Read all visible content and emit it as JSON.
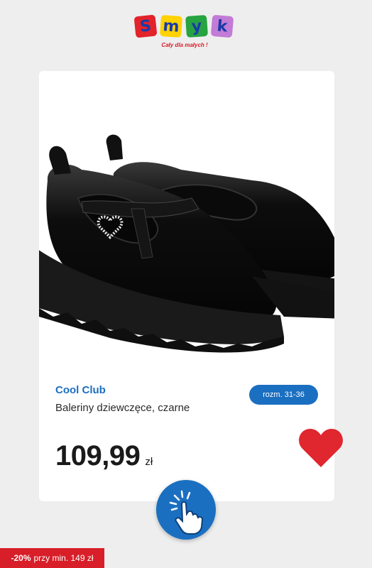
{
  "logo": {
    "letters": [
      "S",
      "m",
      "y",
      "k"
    ],
    "tile_colors": [
      "#e2232a",
      "#ffd200",
      "#27a342",
      "#c27bd6"
    ],
    "tagline": "Cały dla małych !"
  },
  "product": {
    "brand": "Cool Club",
    "name": "Baleriny dziewczęce, czarne",
    "size_label": "rozm. 31-36",
    "price": "109,99",
    "currency": "zł"
  },
  "icons": {
    "favorite": "heart-icon",
    "tap": "tap-hand-icon"
  },
  "promo": {
    "discount": "-20%",
    "condition": "przy min. 149 zł"
  },
  "colors": {
    "accent": "#1b6fc0",
    "heart": "#e0262e",
    "promo_bg": "#d81e28"
  }
}
